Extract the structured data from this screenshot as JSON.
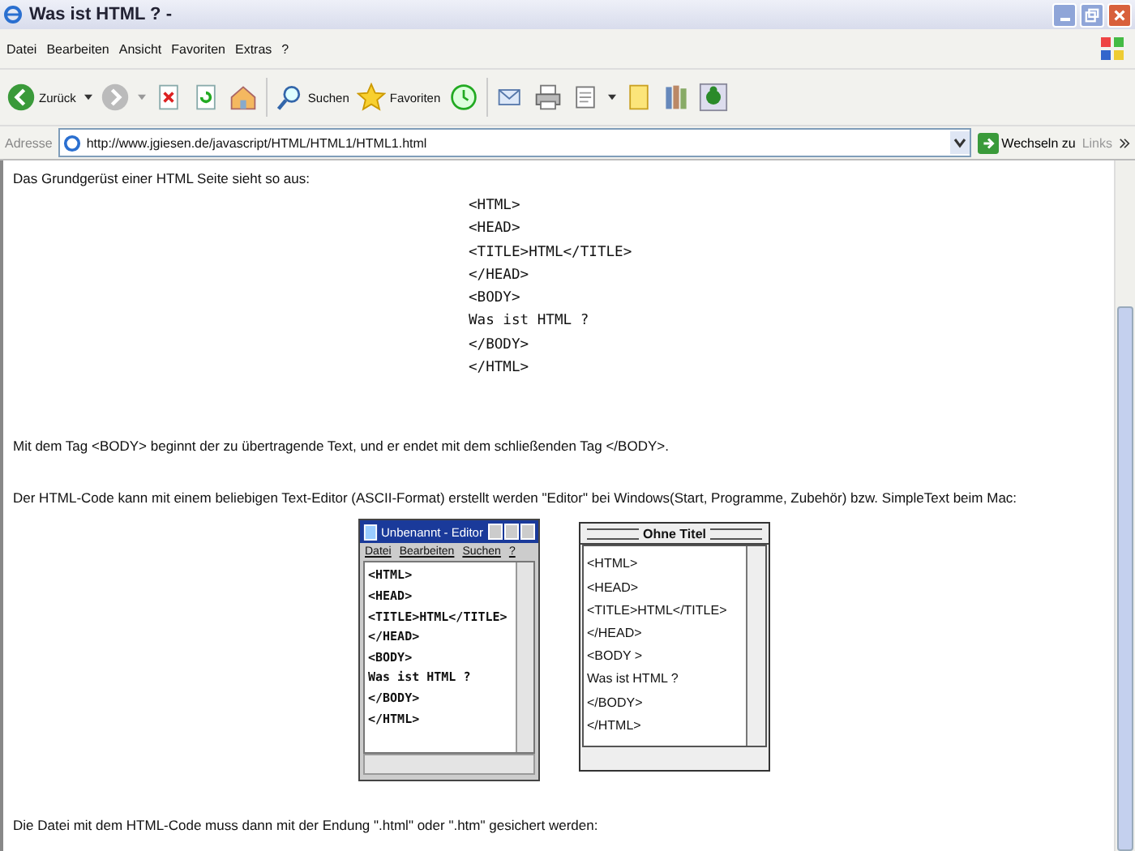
{
  "window": {
    "title": "Was ist HTML ? -"
  },
  "menu": [
    "Datei",
    "Bearbeiten",
    "Ansicht",
    "Favoriten",
    "Extras",
    "?"
  ],
  "toolbar": {
    "back": "Zurück",
    "search": "Suchen",
    "favorites": "Favoriten"
  },
  "address_bar": {
    "label": "Adresse",
    "value": "http://www.jgiesen.de/javascript/HTML/HTML1/HTML1.html",
    "go": "Wechseln zu",
    "links": "Links"
  },
  "content": {
    "intro": "Das Grundgerüst einer HTML Seite sieht so aus:",
    "code_lines": [
      "<HTML>",
      "<HEAD>",
      "<TITLE>HTML</TITLE>",
      "</HEAD>",
      "<BODY>",
      "Was ist HTML ?",
      "</BODY>",
      "</HTML>"
    ],
    "paragraph_body": "Mit dem Tag <BODY> beginnt der zu übertragende Text, und er endet mit dem schließenden Tag </BODY>.",
    "paragraph_editor": "Der HTML-Code kann mit einem beliebigen Text-Editor (ASCII-Format) erstellt werden \"Editor\" bei Windows(Start, Programme, Zubehör) bzw. SimpleText beim Mac:",
    "notepad": {
      "title": "Unbenannt - Editor",
      "menu": [
        "Datei",
        "Bearbeiten",
        "Suchen",
        "?"
      ],
      "lines": [
        "<HTML>",
        "<HEAD>",
        "<TITLE>HTML</TITLE>",
        "</HEAD>",
        "<BODY>",
        "Was ist HTML ?",
        "</BODY>",
        "</HTML>"
      ]
    },
    "mac_editor": {
      "title": "Ohne Titel",
      "lines": [
        "<HTML>",
        "<HEAD>",
        "<TITLE>HTML</TITLE>",
        "</HEAD>",
        "<BODY >",
        "Was ist HTML ?",
        "</BODY>",
        "</HTML>"
      ]
    },
    "paragraph_save": "Die Datei mit dem HTML-Code muss dann mit der Endung \".html\" oder \".htm\" gesichert werden:"
  }
}
